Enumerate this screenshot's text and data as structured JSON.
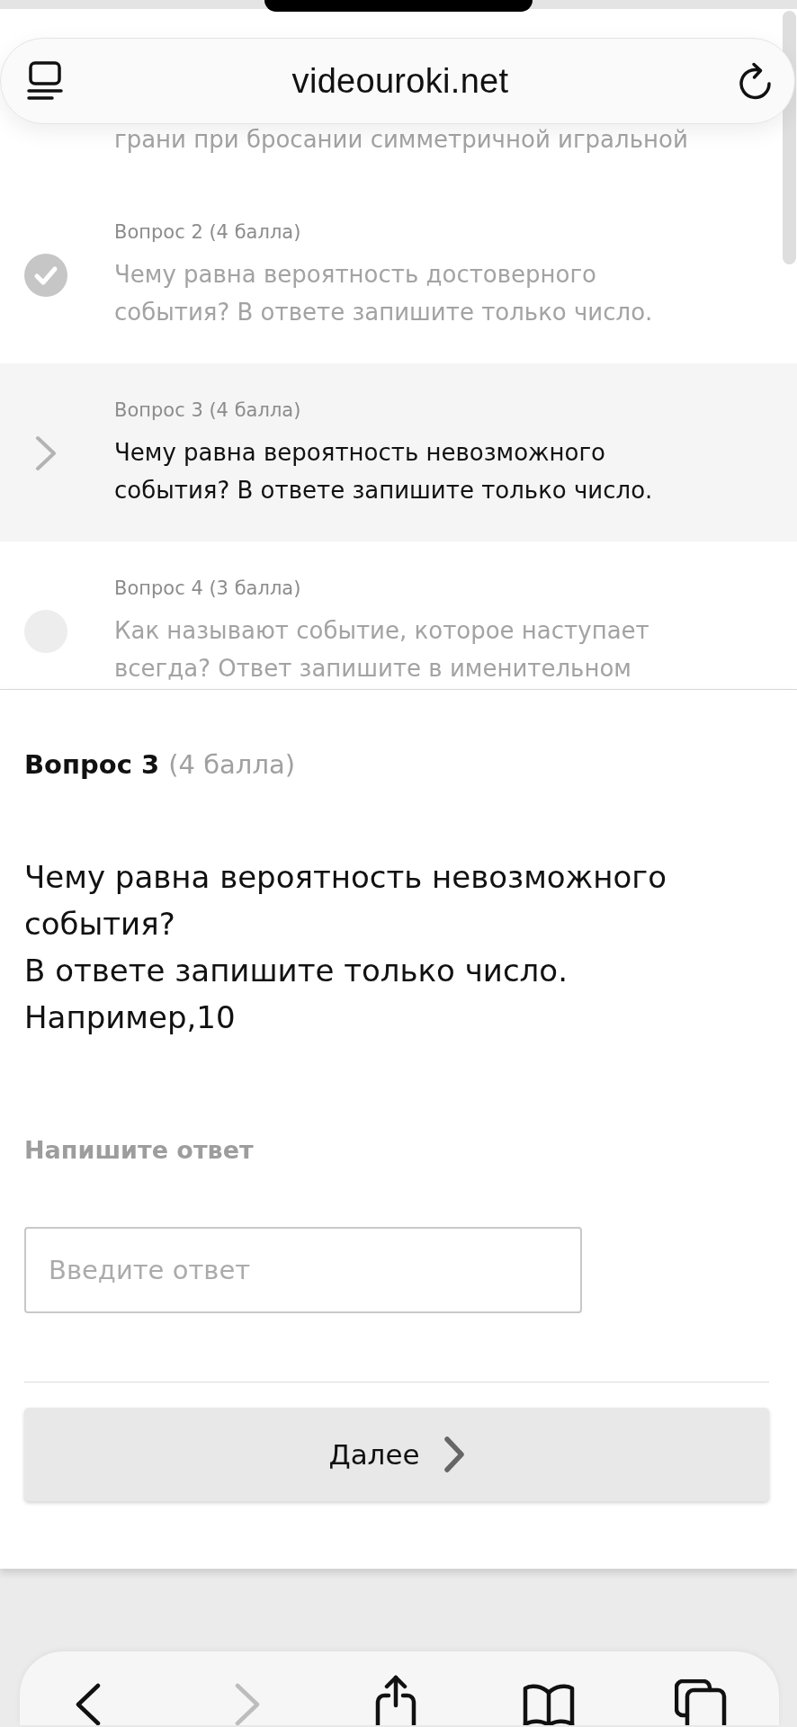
{
  "browser": {
    "url": "videouroki.net",
    "back_disabled": false,
    "forward_disabled": true
  },
  "question_list": [
    {
      "kind": "partial",
      "text": "грани при бросании симметричной игральной",
      "selected": false
    },
    {
      "kind": "item",
      "label": "Вопрос 2 (4 балла)",
      "text": "Чему равна вероятность достоверного события? В ответе запишите только число.",
      "answered": true,
      "selected": false
    },
    {
      "kind": "item",
      "label": "Вопрос 3 (4 балла)",
      "text": "Чему равна вероятность невозможного события? В ответе запишите только число.",
      "answered": false,
      "selected": true
    },
    {
      "kind": "item",
      "label": "Вопрос 4 (3 балла)",
      "text": "Как называют событие, которое наступает всегда? Ответ запишите в именительном",
      "answered": false,
      "selected": false
    }
  ],
  "question": {
    "title": "Вопрос 3",
    "points": "(4 балла)",
    "text": "Чему равна вероятность невозможного события?\nВ ответе запишите только число.\nНапример,10"
  },
  "answer": {
    "label": "Напишите ответ",
    "placeholder": "Введите ответ"
  },
  "next_button": {
    "label": "Далее"
  }
}
